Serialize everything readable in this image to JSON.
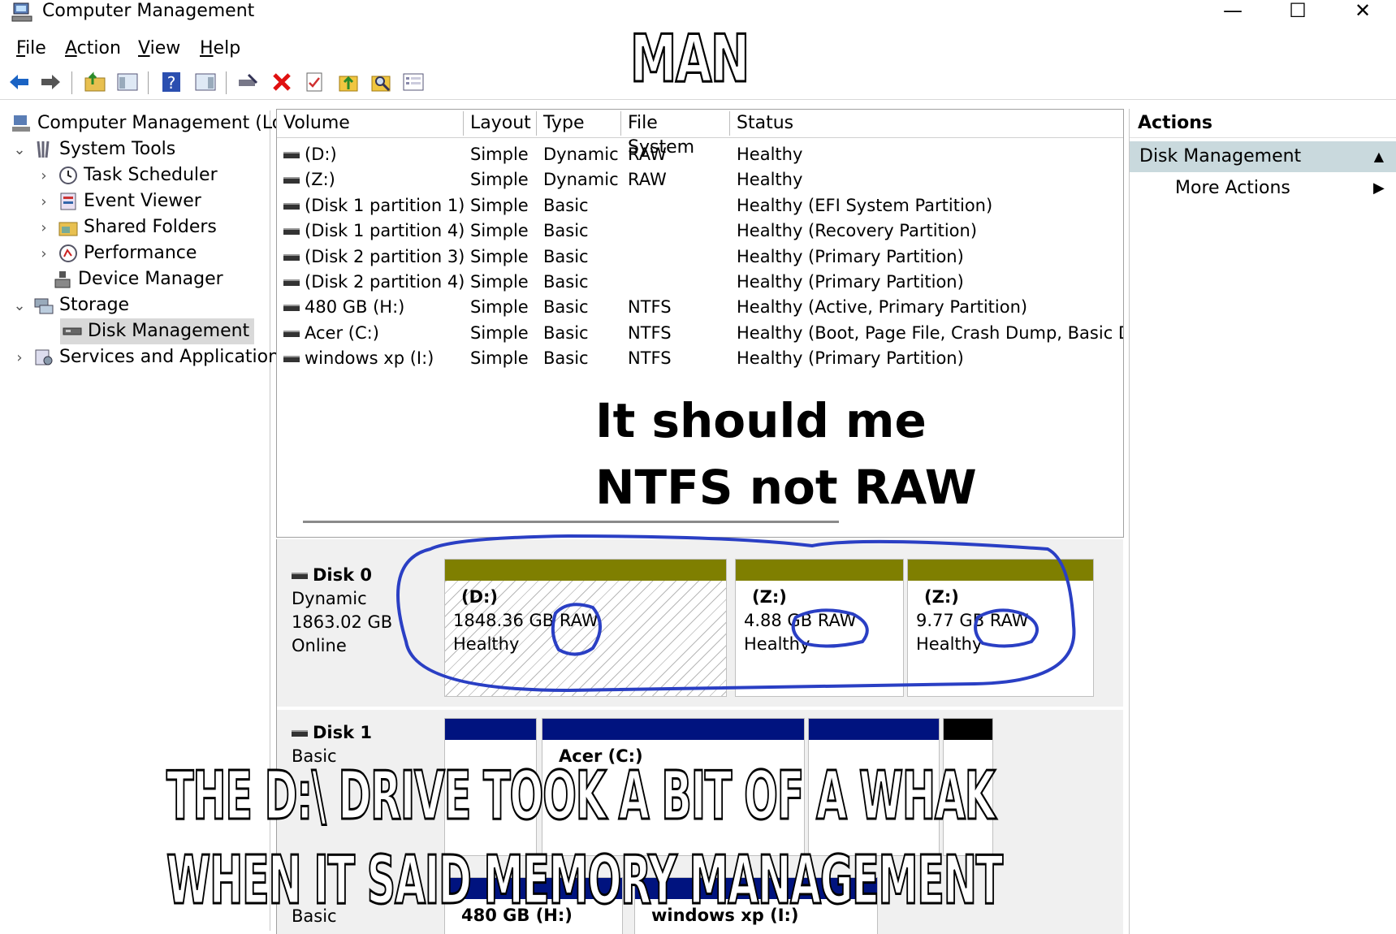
{
  "window": {
    "title": "Computer Management",
    "minimize": "—",
    "maximize": "☐",
    "close": "✕"
  },
  "menu": [
    {
      "label": "File",
      "underline": "F",
      "rest": "ile"
    },
    {
      "label": "Action",
      "underline": "A",
      "rest": "ction"
    },
    {
      "label": "View",
      "underline": "V",
      "rest": "iew"
    },
    {
      "label": "Help",
      "underline": "H",
      "rest": "elp"
    }
  ],
  "toolbar": {
    "icons": [
      "back-arrow-icon",
      "forward-arrow-icon",
      "up-folder-icon",
      "show-hide-tree-icon",
      "help-icon",
      "action-pane-icon",
      "connect-icon",
      "delete-icon",
      "properties-icon",
      "import-icon",
      "search-icon",
      "list-view-icon"
    ],
    "accent": "#1a63c4",
    "delete_color": "#e01010"
  },
  "tree": {
    "root": "Computer Management (Lo",
    "system_tools": "System Tools",
    "task_scheduler": "Task Scheduler",
    "event_viewer": "Event Viewer",
    "shared_folders": "Shared Folders",
    "performance": "Performance",
    "device_manager": "Device Manager",
    "storage": "Storage",
    "disk_management": "Disk Management",
    "services": "Services and Application"
  },
  "volumes": {
    "headers": [
      "Volume",
      "Layout",
      "Type",
      "File System",
      "Status"
    ],
    "rows": [
      {
        "volume": "(D:)",
        "layout": "Simple",
        "type": "Dynamic",
        "fs": "RAW",
        "status": "Healthy"
      },
      {
        "volume": "(Z:)",
        "layout": "Simple",
        "type": "Dynamic",
        "fs": "RAW",
        "status": "Healthy"
      },
      {
        "volume": "(Disk 1 partition 1)",
        "layout": "Simple",
        "type": "Basic",
        "fs": "",
        "status": "Healthy (EFI System Partition)"
      },
      {
        "volume": "(Disk 1 partition 4)",
        "layout": "Simple",
        "type": "Basic",
        "fs": "",
        "status": "Healthy (Recovery Partition)"
      },
      {
        "volume": "(Disk 2 partition 3)",
        "layout": "Simple",
        "type": "Basic",
        "fs": "",
        "status": "Healthy (Primary Partition)"
      },
      {
        "volume": "(Disk 2 partition 4)",
        "layout": "Simple",
        "type": "Basic",
        "fs": "",
        "status": "Healthy (Primary Partition)"
      },
      {
        "volume": "480 GB (H:)",
        "layout": "Simple",
        "type": "Basic",
        "fs": "NTFS",
        "status": "Healthy (Active, Primary Partition)"
      },
      {
        "volume": "Acer (C:)",
        "layout": "Simple",
        "type": "Basic",
        "fs": "NTFS",
        "status": "Healthy (Boot, Page File, Crash Dump, Basic Da"
      },
      {
        "volume": "windows xp (I:)",
        "layout": "Simple",
        "type": "Basic",
        "fs": "NTFS",
        "status": "Healthy (Primary Partition)"
      }
    ]
  },
  "annotation": {
    "line1": "It should me",
    "line2": "NTFS not RAW",
    "circle_color": "#2a3fc4"
  },
  "disks": {
    "disk0": {
      "name": "Disk 0",
      "type": "Dynamic",
      "size": "1863.02 GB",
      "state": "Online",
      "bar_color": "#7f7f00",
      "partitions": [
        {
          "name": "(D:)",
          "size": "1848.36 GB",
          "fs": "RAW",
          "status": "Healthy"
        },
        {
          "name": "(Z:)",
          "size": "4.88 GB",
          "fs": "RAW",
          "status": "Healthy"
        },
        {
          "name": "(Z:)",
          "size": "9.77 GB",
          "fs": "RAW",
          "status": "Healthy"
        }
      ]
    },
    "disk1": {
      "name": "Disk 1",
      "type": "Basic",
      "partial_label": "Acer (C:)",
      "bar_color": "#00137f"
    },
    "disk2": {
      "type": "Basic",
      "partitions": [
        "480 GB (H:)",
        "windows xp (I:)"
      ]
    }
  },
  "actions": {
    "title": "Actions",
    "section": "Disk Management",
    "more": "More Actions"
  },
  "meme": {
    "top": "MAN",
    "bottom1": "THE D:\\ DRIVE TOOK A BIT OF A WHAK",
    "bottom2": "WHEN IT SAID MEMORY MANAGEMENT"
  }
}
